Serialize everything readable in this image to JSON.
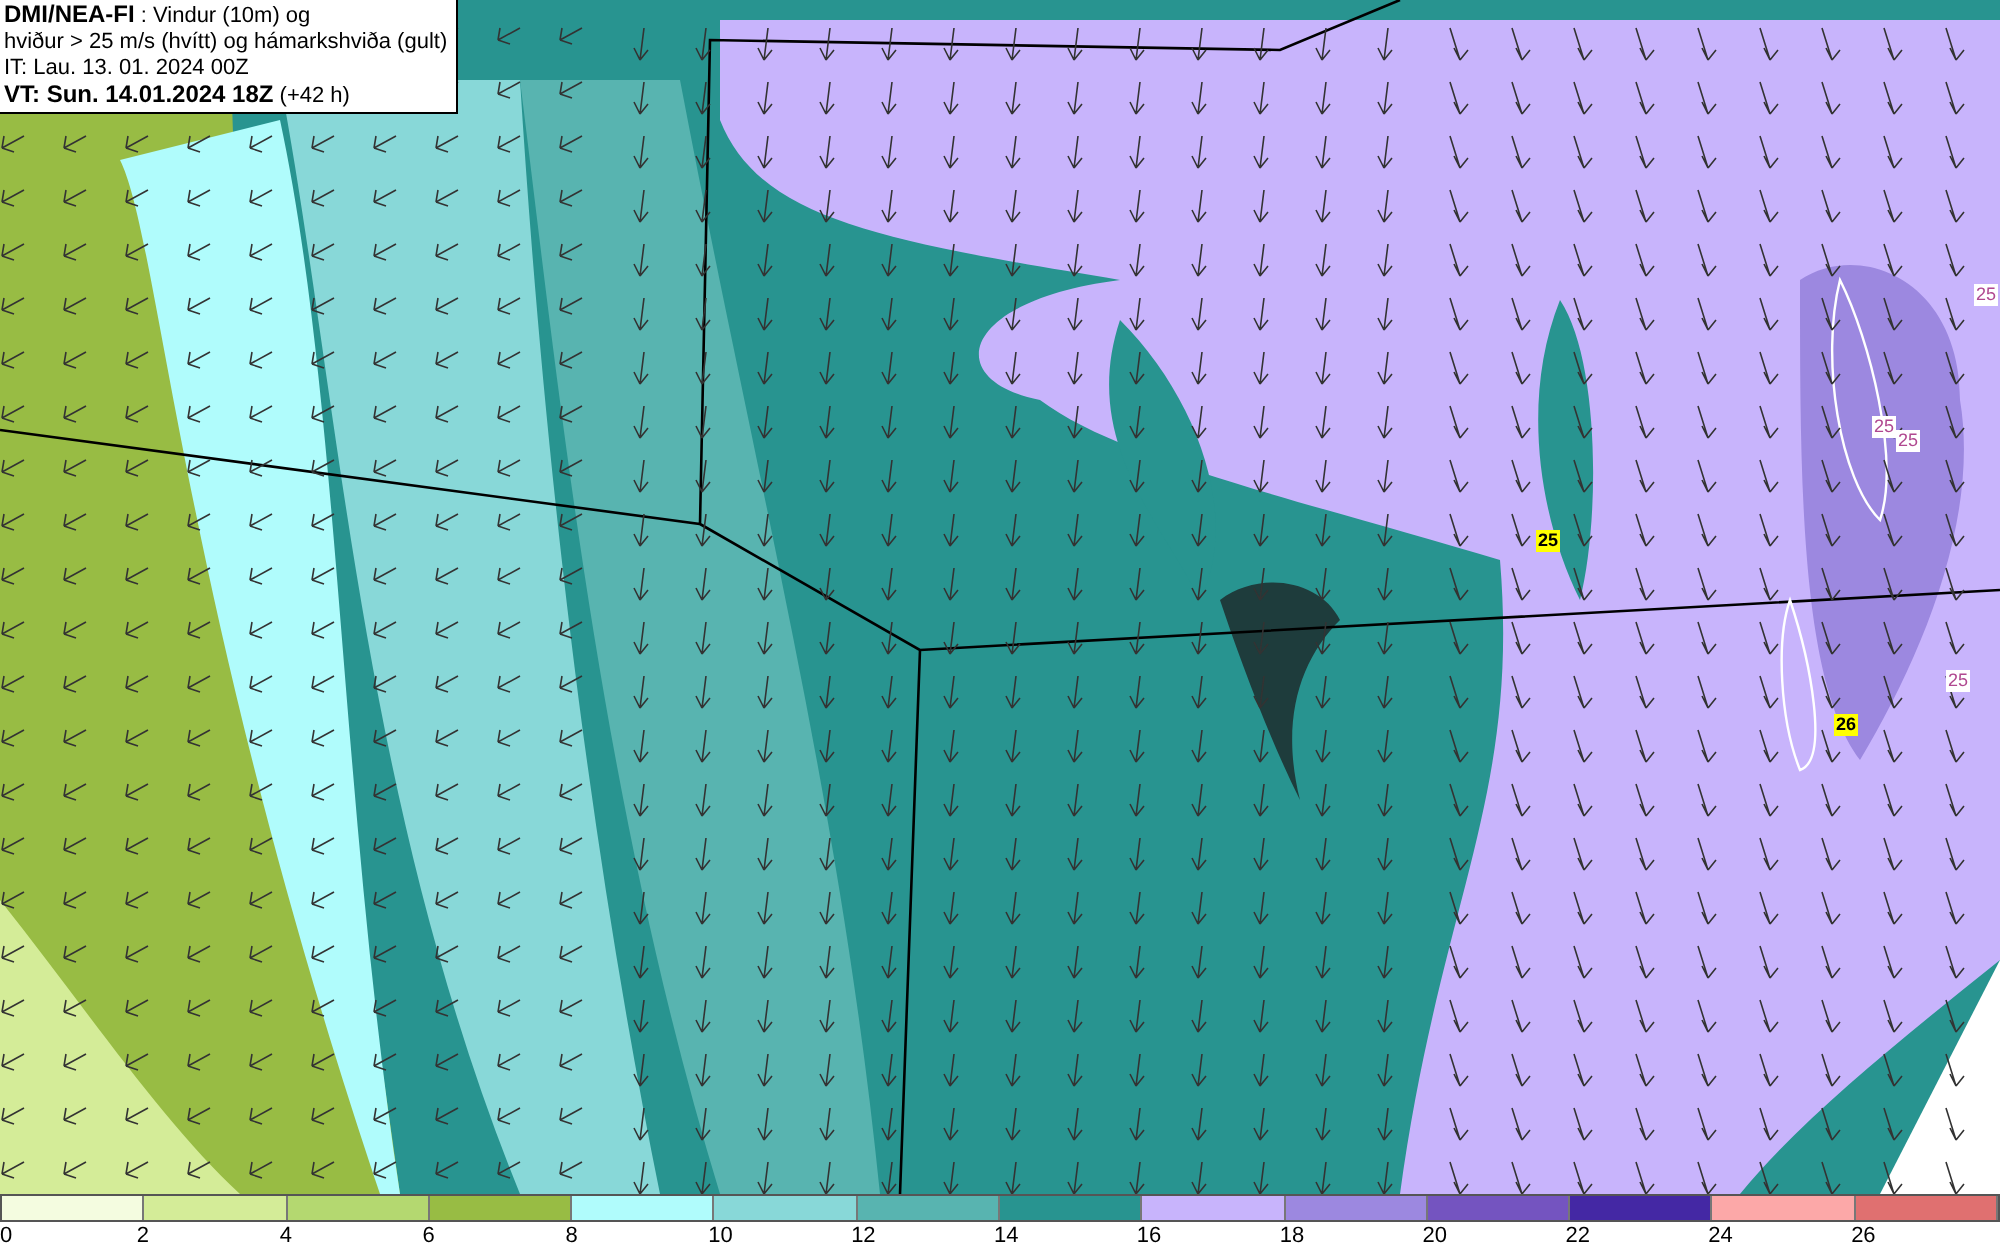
{
  "title_box": {
    "model": "DMI/NEA-FI",
    "product": " : Vindur (10m) og",
    "line2": "hviður > 25 m/s (hvítt) og hámarkshviða (gult)",
    "issue": "IT: Lau. 13. 01. 2024 00Z",
    "valid": "VT: Sun. 14.01.2024 18Z",
    "lead": " (+42 h)"
  },
  "contour_labels": [
    {
      "text": "25",
      "kind": "gust"
    },
    {
      "text": "25",
      "kind": "gust"
    },
    {
      "text": "25",
      "kind": "gust"
    },
    {
      "text": "25",
      "kind": "gust"
    },
    {
      "text": "25",
      "kind": "max"
    },
    {
      "text": "26",
      "kind": "max"
    }
  ],
  "legend": [
    {
      "label": "0",
      "color": "#f4fce0"
    },
    {
      "label": "2",
      "color": "#d4ec98"
    },
    {
      "label": "4",
      "color": "#b4d870"
    },
    {
      "label": "6",
      "color": "#98bc44"
    },
    {
      "label": "8",
      "color": "#b0fcfc"
    },
    {
      "label": "10",
      "color": "#88d8d8"
    },
    {
      "label": "12",
      "color": "#58b4b0"
    },
    {
      "label": "14",
      "color": "#289490"
    },
    {
      "label": "16",
      "color": "#c8b4fc"
    },
    {
      "label": "18",
      "color": "#9c88e0"
    },
    {
      "label": "20",
      "color": "#7454c0"
    },
    {
      "label": "22",
      "color": "#4428a4"
    },
    {
      "label": "24",
      "color": "#fca8a8"
    },
    {
      "label": "26",
      "color": "#e07070"
    }
  ]
}
